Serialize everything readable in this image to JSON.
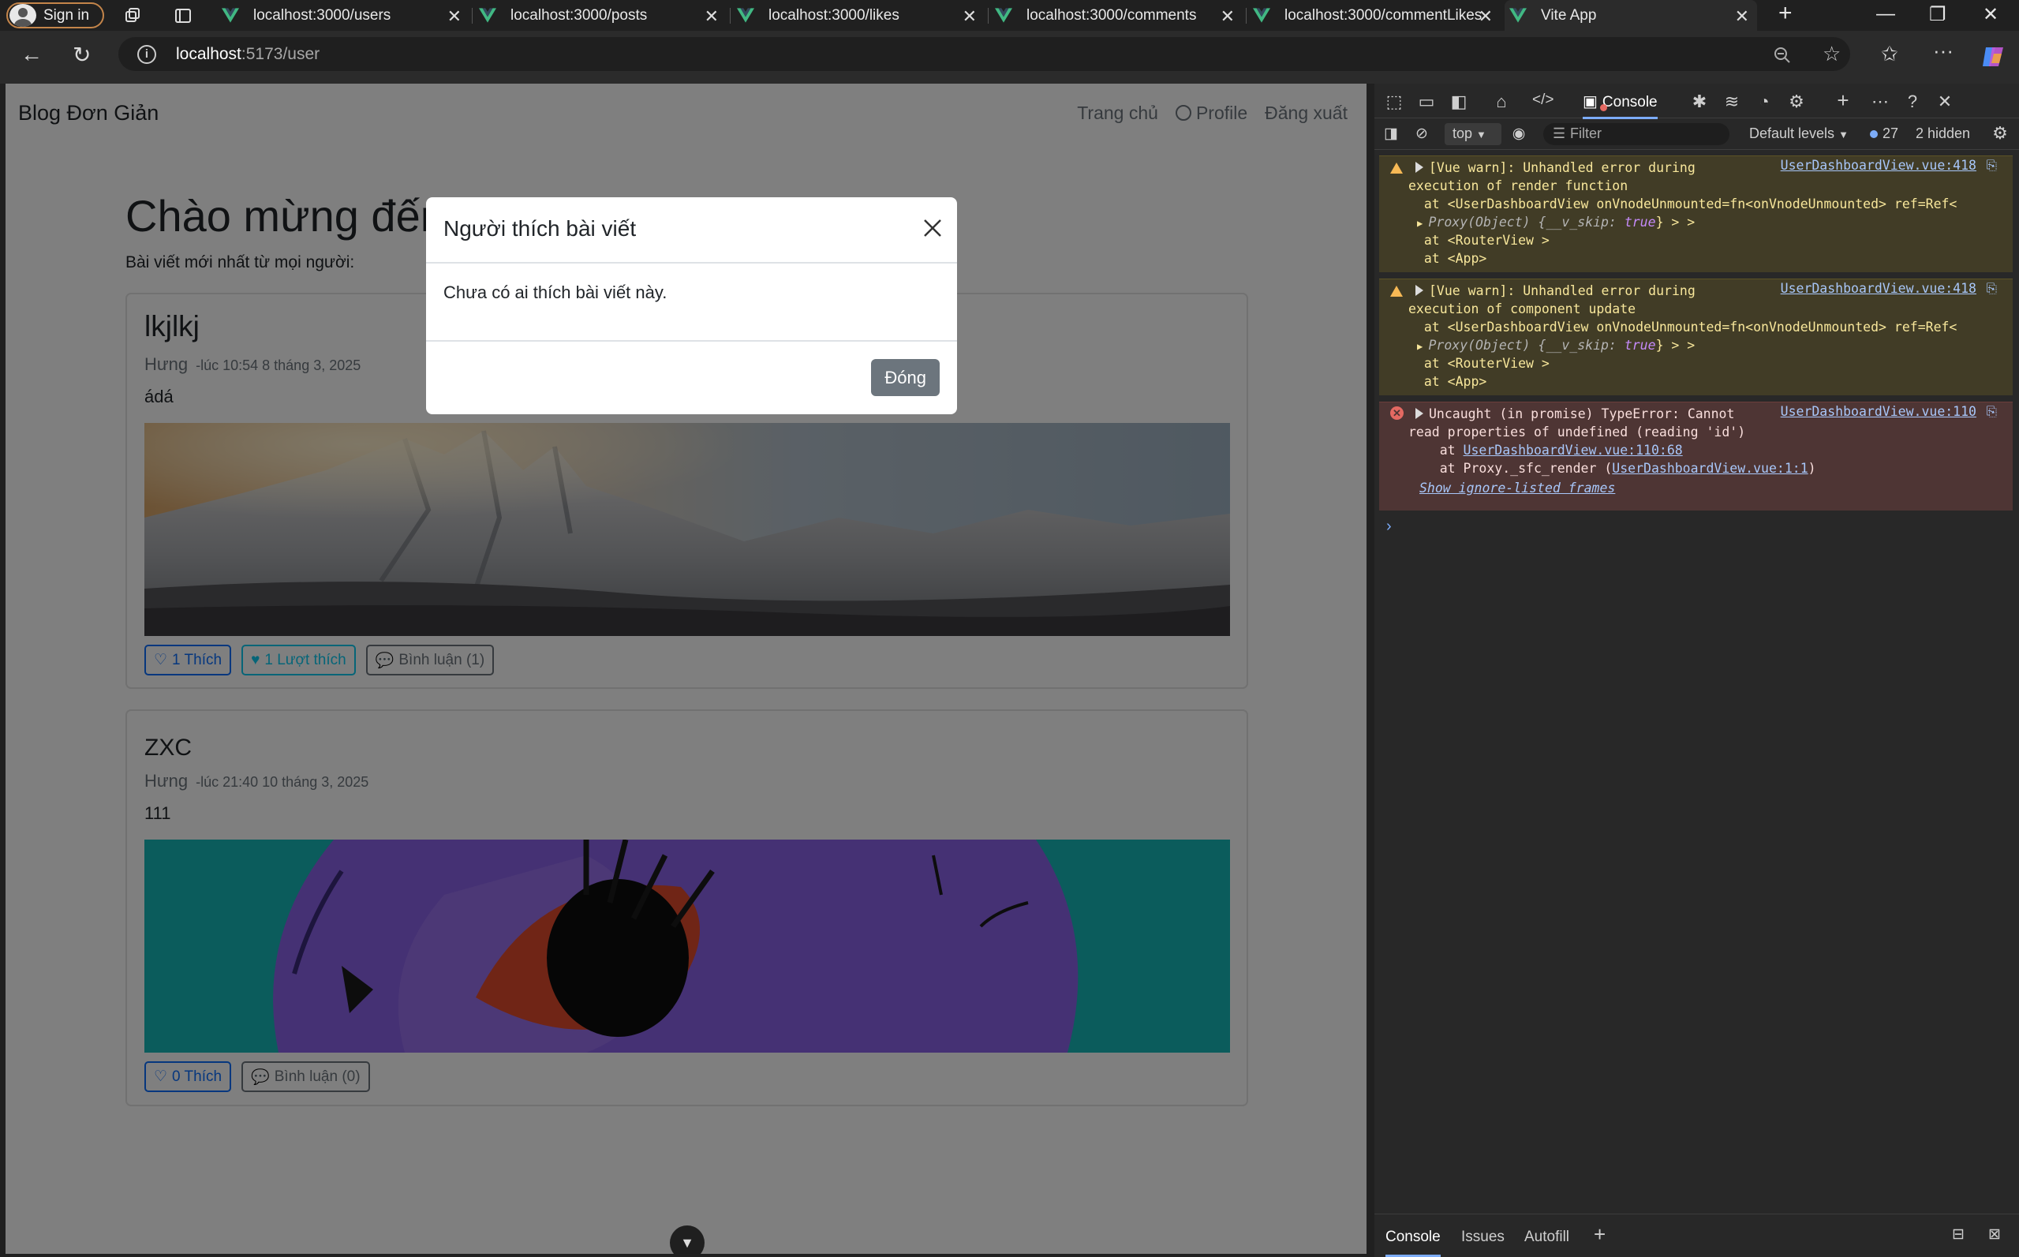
{
  "browser": {
    "signin_label": "Sign in",
    "tabs": [
      {
        "title": "localhost:3000/users"
      },
      {
        "title": "localhost:3000/posts"
      },
      {
        "title": "localhost:3000/likes"
      },
      {
        "title": "localhost:3000/comments"
      },
      {
        "title": "localhost:3000/commentLikes"
      },
      {
        "title": "Vite App"
      }
    ],
    "new_tab_label": "+",
    "address": {
      "host": "localhost",
      "path": ":5173/user"
    }
  },
  "page": {
    "brand": "Blog Đơn Giản",
    "nav": {
      "home": "Trang chủ",
      "profile": "Profile",
      "logout": "Đăng xuất"
    },
    "welcome": "Chào mừng đến",
    "subtitle": "Bài viết mới nhất từ mọi người:",
    "posts": [
      {
        "title": "lkjlkj",
        "author": "Hưng",
        "time": "-lúc 10:54 8 tháng 3, 2025",
        "content": "ádá",
        "like_label": "1 Thích",
        "likes_count_label": "1 Lượt thích",
        "comment_label": "Bình luận (1)"
      },
      {
        "title": "ZXC",
        "author": "Hưng",
        "time": "-lúc 21:40 10 tháng 3, 2025",
        "content": "111",
        "like_label": "0 Thích",
        "comment_label": "Bình luận (0)"
      }
    ]
  },
  "modal": {
    "title": "Người thích bài viết",
    "body": "Chưa có ai thích bài viết này.",
    "close_button": "Đóng"
  },
  "devtools": {
    "active_tab": "Console",
    "context": "top",
    "filter_placeholder": "Filter",
    "levels": "Default levels",
    "message_count": "27",
    "hidden_count": "2 hidden",
    "messages": [
      {
        "level": "warning",
        "source": "UserDashboardView.vue:418",
        "line1": "[Vue warn]: Unhandled error during",
        "line2": "execution of render function",
        "line3": "  at <UserDashboardView onVnodeUnmounted=fn<onVnodeUnmounted> ref=Ref<",
        "proxy": "Proxy(Object) {__v_skip: ",
        "proxy_val": "true",
        "proxy_end": "} > >",
        "line5": "  at <RouterView >",
        "line6": "  at <App>"
      },
      {
        "level": "warning",
        "source": "UserDashboardView.vue:418",
        "line1": "[Vue warn]: Unhandled error during",
        "line2": "execution of component update",
        "line3": "  at <UserDashboardView onVnodeUnmounted=fn<onVnodeUnmounted> ref=Ref<",
        "proxy": "Proxy(Object) {__v_skip: ",
        "proxy_val": "true",
        "proxy_end": "} > >",
        "line5": "  at <RouterView >",
        "line6": "  at <App>"
      },
      {
        "level": "error",
        "source": "UserDashboardView.vue:110",
        "line1": "Uncaught (in promise) TypeError: Cannot",
        "line2": "read properties of undefined (reading 'id')",
        "line3_prefix": "    at ",
        "line3_link": "UserDashboardView.vue:110:68",
        "line4_prefix": "    at Proxy._sfc_render (",
        "line4_link": "UserDashboardView.vue:1:1",
        "line4_suffix": ")",
        "show_ignore": "Show ignore-listed frames"
      }
    ],
    "drawer_tabs": [
      "Console",
      "Issues",
      "Autofill"
    ]
  }
}
